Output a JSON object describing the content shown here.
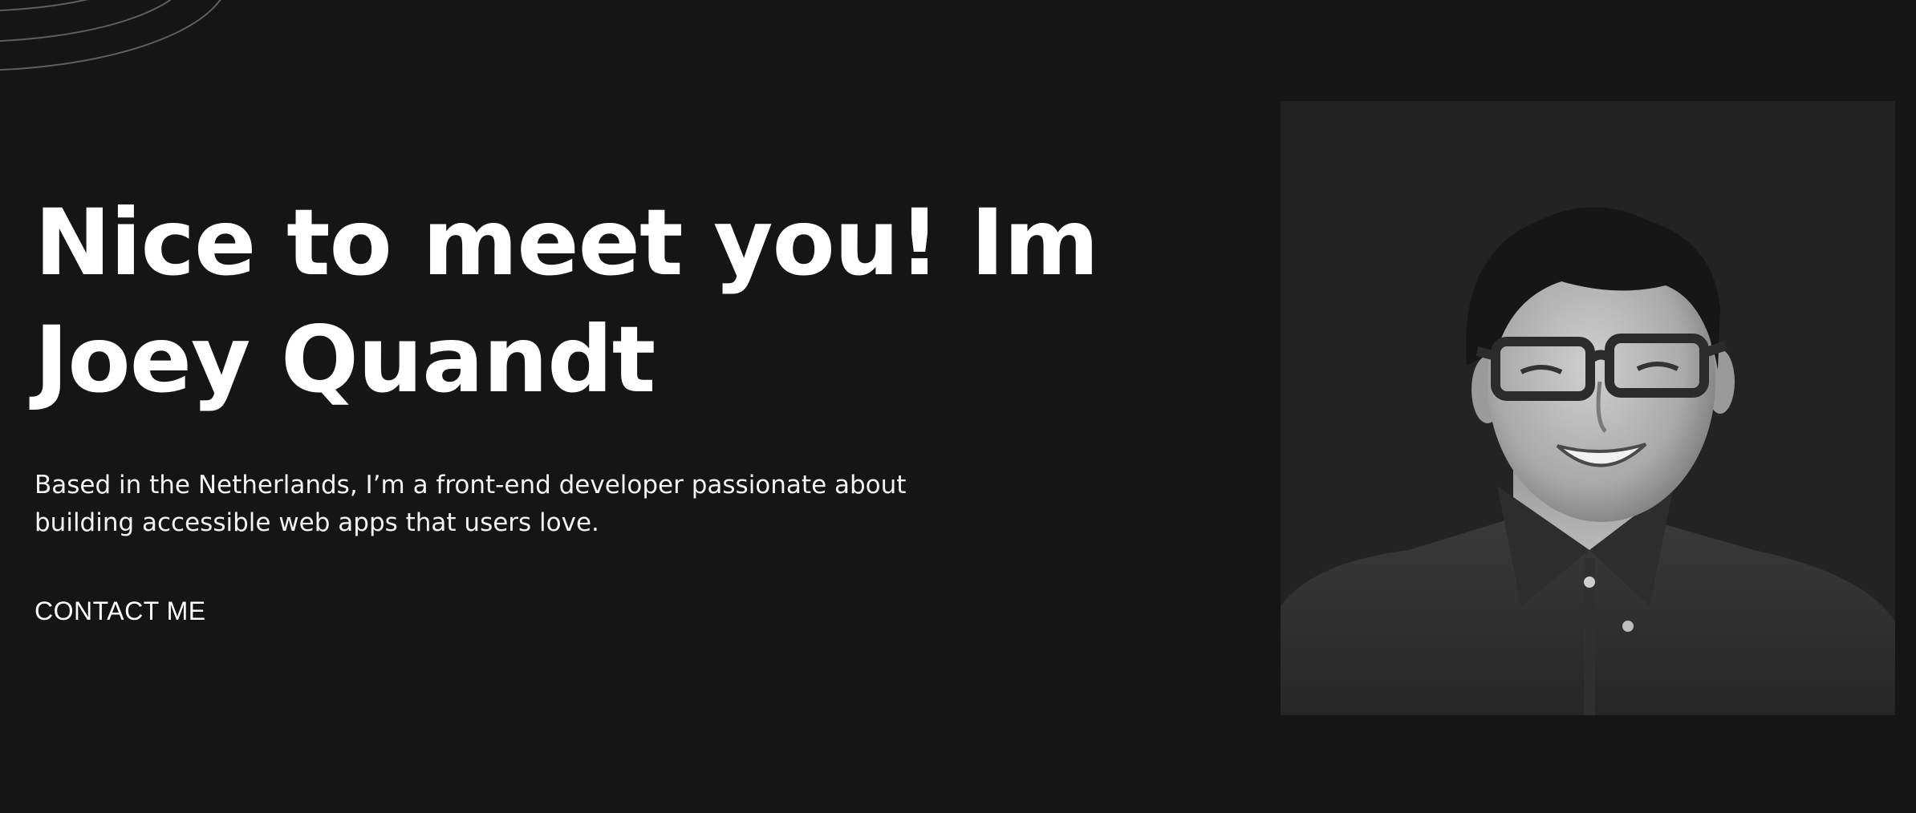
{
  "hero": {
    "title_line1": "Nice to meet you! Im",
    "title_line2": "Joey Quandt",
    "subtitle_line1": "Based in the Netherlands, I’m a front-end developer passionate about",
    "subtitle_line2": "building accessible web apps that users love.",
    "contact_label": "CONTACT ME"
  },
  "portrait": {
    "alt": "portrait photo"
  },
  "colors": {
    "background": "#151515",
    "portrait_bg": "#232323",
    "text": "#ffffff"
  }
}
